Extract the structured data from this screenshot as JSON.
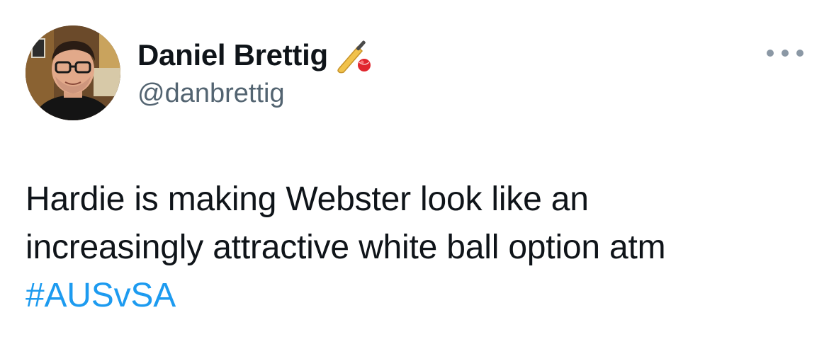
{
  "author": {
    "display_name": "Daniel Brettig",
    "name_emoji": "cricket-bat-and-ball-icon",
    "handle": "@danbrettig",
    "avatar": "avatar"
  },
  "more_menu": {
    "icon": "more-icon"
  },
  "tweet": {
    "line1": "Hardie is making Webster look like an",
    "line2": "increasingly attractive white ball option atm",
    "hashtag": "#AUSvSA"
  },
  "colors": {
    "text": "#0f1419",
    "secondary": "#536471",
    "link": "#1d9bf0",
    "background": "#ffffff"
  }
}
